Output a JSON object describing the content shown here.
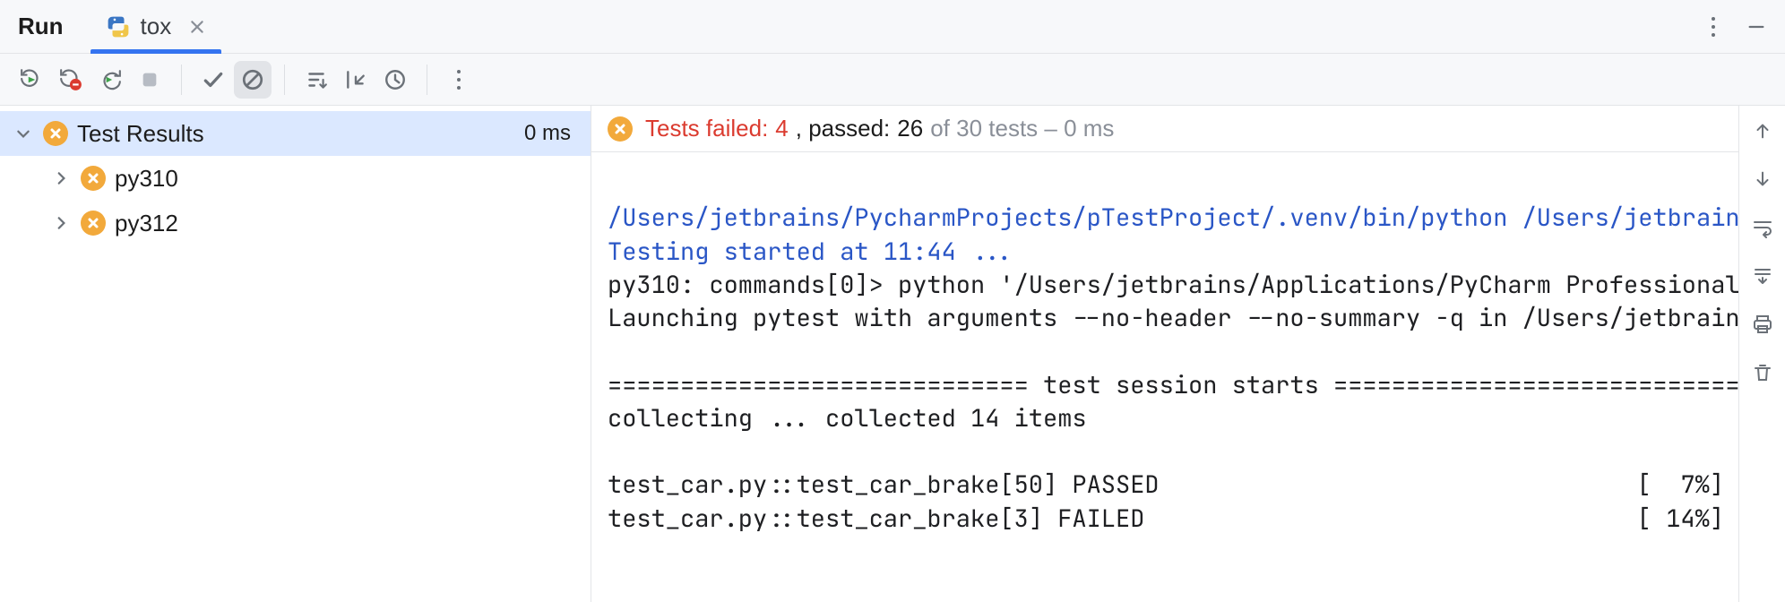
{
  "header": {
    "run_label": "Run",
    "tab_label": "tox"
  },
  "tree": {
    "root": {
      "label": "Test Results",
      "time": "0 ms"
    },
    "nodes": [
      {
        "label": "py310"
      },
      {
        "label": "py312"
      }
    ]
  },
  "summary": {
    "failed_prefix": "Tests failed: ",
    "failed_count": "4",
    "passed_prefix": ", passed: ",
    "passed_count": "26",
    "of_text": " of 30 tests – 0 ms"
  },
  "console": {
    "python_path": "/Users/jetbrains/PycharmProjects/pTestProject/.venv/bin/python /Users/jetbrains",
    "started": "Testing started at 11:44 ...",
    "line_cmd": "py310: commands[0]> python '/Users/jetbrains/Applications/PyCharm Professional",
    "line_launch": "Launching pytest with arguments --no-header --no-summary -q in /Users/jetbrains",
    "blank": "",
    "session_rule": "============================= test session starts =============================",
    "collecting": "collecting ... collected 14 items",
    "t1_name": "test_car.py::test_car_brake[50] PASSED",
    "t1_pct": "[  7%]",
    "t2_name": "test_car.py::test_car_brake[3] FAILED",
    "t2_pct": "[ 14%]"
  }
}
